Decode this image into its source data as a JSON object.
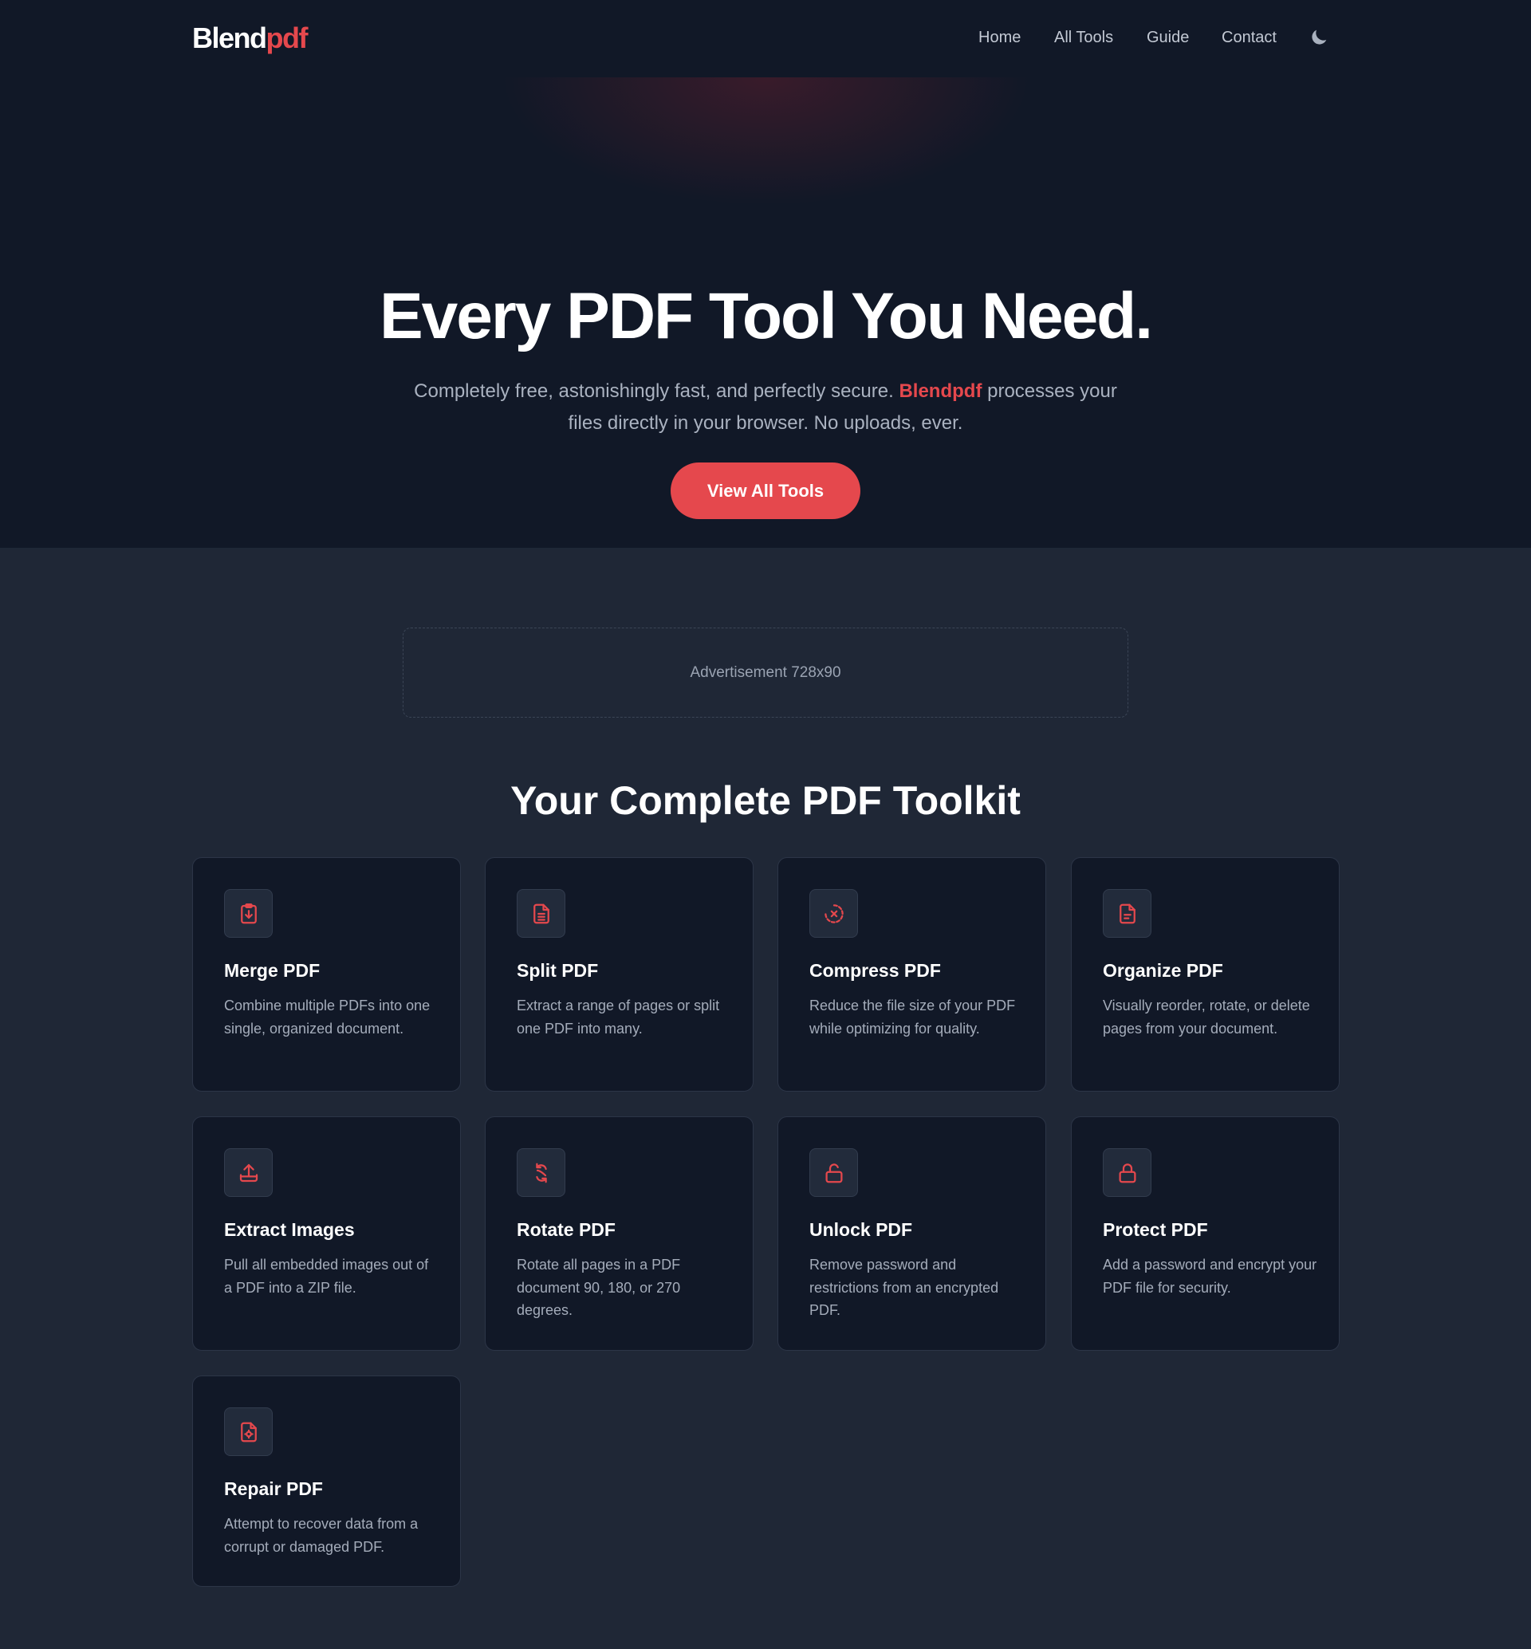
{
  "header": {
    "logo_part1": "Blend",
    "logo_part2": "pdf",
    "nav": [
      "Home",
      "All Tools",
      "Guide",
      "Contact"
    ],
    "theme_icon": "moon-icon"
  },
  "hero": {
    "title": "Every PDF Tool You Need.",
    "subtitle_before": "Completely free, astonishingly fast, and perfectly secure.",
    "subtitle_brand": "Blendpdf",
    "subtitle_after": "processes your files directly in your browser. No uploads, ever.",
    "cta_label": "View All Tools"
  },
  "ad": {
    "label": "Advertisement 728x90"
  },
  "toolkit": {
    "title": "Your Complete PDF Toolkit",
    "tools": [
      {
        "name": "Merge PDF",
        "description": "Combine multiple PDFs into one single, organized document.",
        "icon": "clipboard-merge-icon"
      },
      {
        "name": "Split PDF",
        "description": "Extract a range of pages or split one PDF into many.",
        "icon": "document-lines-icon"
      },
      {
        "name": "Compress PDF",
        "description": "Reduce the file size of your PDF while optimizing for quality.",
        "icon": "compress-circle-icon"
      },
      {
        "name": "Organize PDF",
        "description": "Visually reorder, rotate, or delete pages from your document.",
        "icon": "document-organize-icon"
      },
      {
        "name": "Extract Images",
        "description": "Pull all embedded images out of a PDF into a ZIP file.",
        "icon": "upload-tray-icon"
      },
      {
        "name": "Rotate PDF",
        "description": "Rotate all pages in a PDF document 90, 180, or 270 degrees.",
        "icon": "rotate-icon"
      },
      {
        "name": "Unlock PDF",
        "description": "Remove password and restrictions from an encrypted PDF.",
        "icon": "unlock-icon"
      },
      {
        "name": "Protect PDF",
        "description": "Add a password and encrypt your PDF file for security.",
        "icon": "lock-icon"
      },
      {
        "name": "Repair PDF",
        "description": "Attempt to recover data from a corrupt or damaged PDF.",
        "icon": "document-repair-icon"
      }
    ]
  },
  "colors": {
    "accent": "#e5484d",
    "header_bg": "#111827",
    "page_bg": "#1f2736",
    "card_bg": "#111827"
  }
}
